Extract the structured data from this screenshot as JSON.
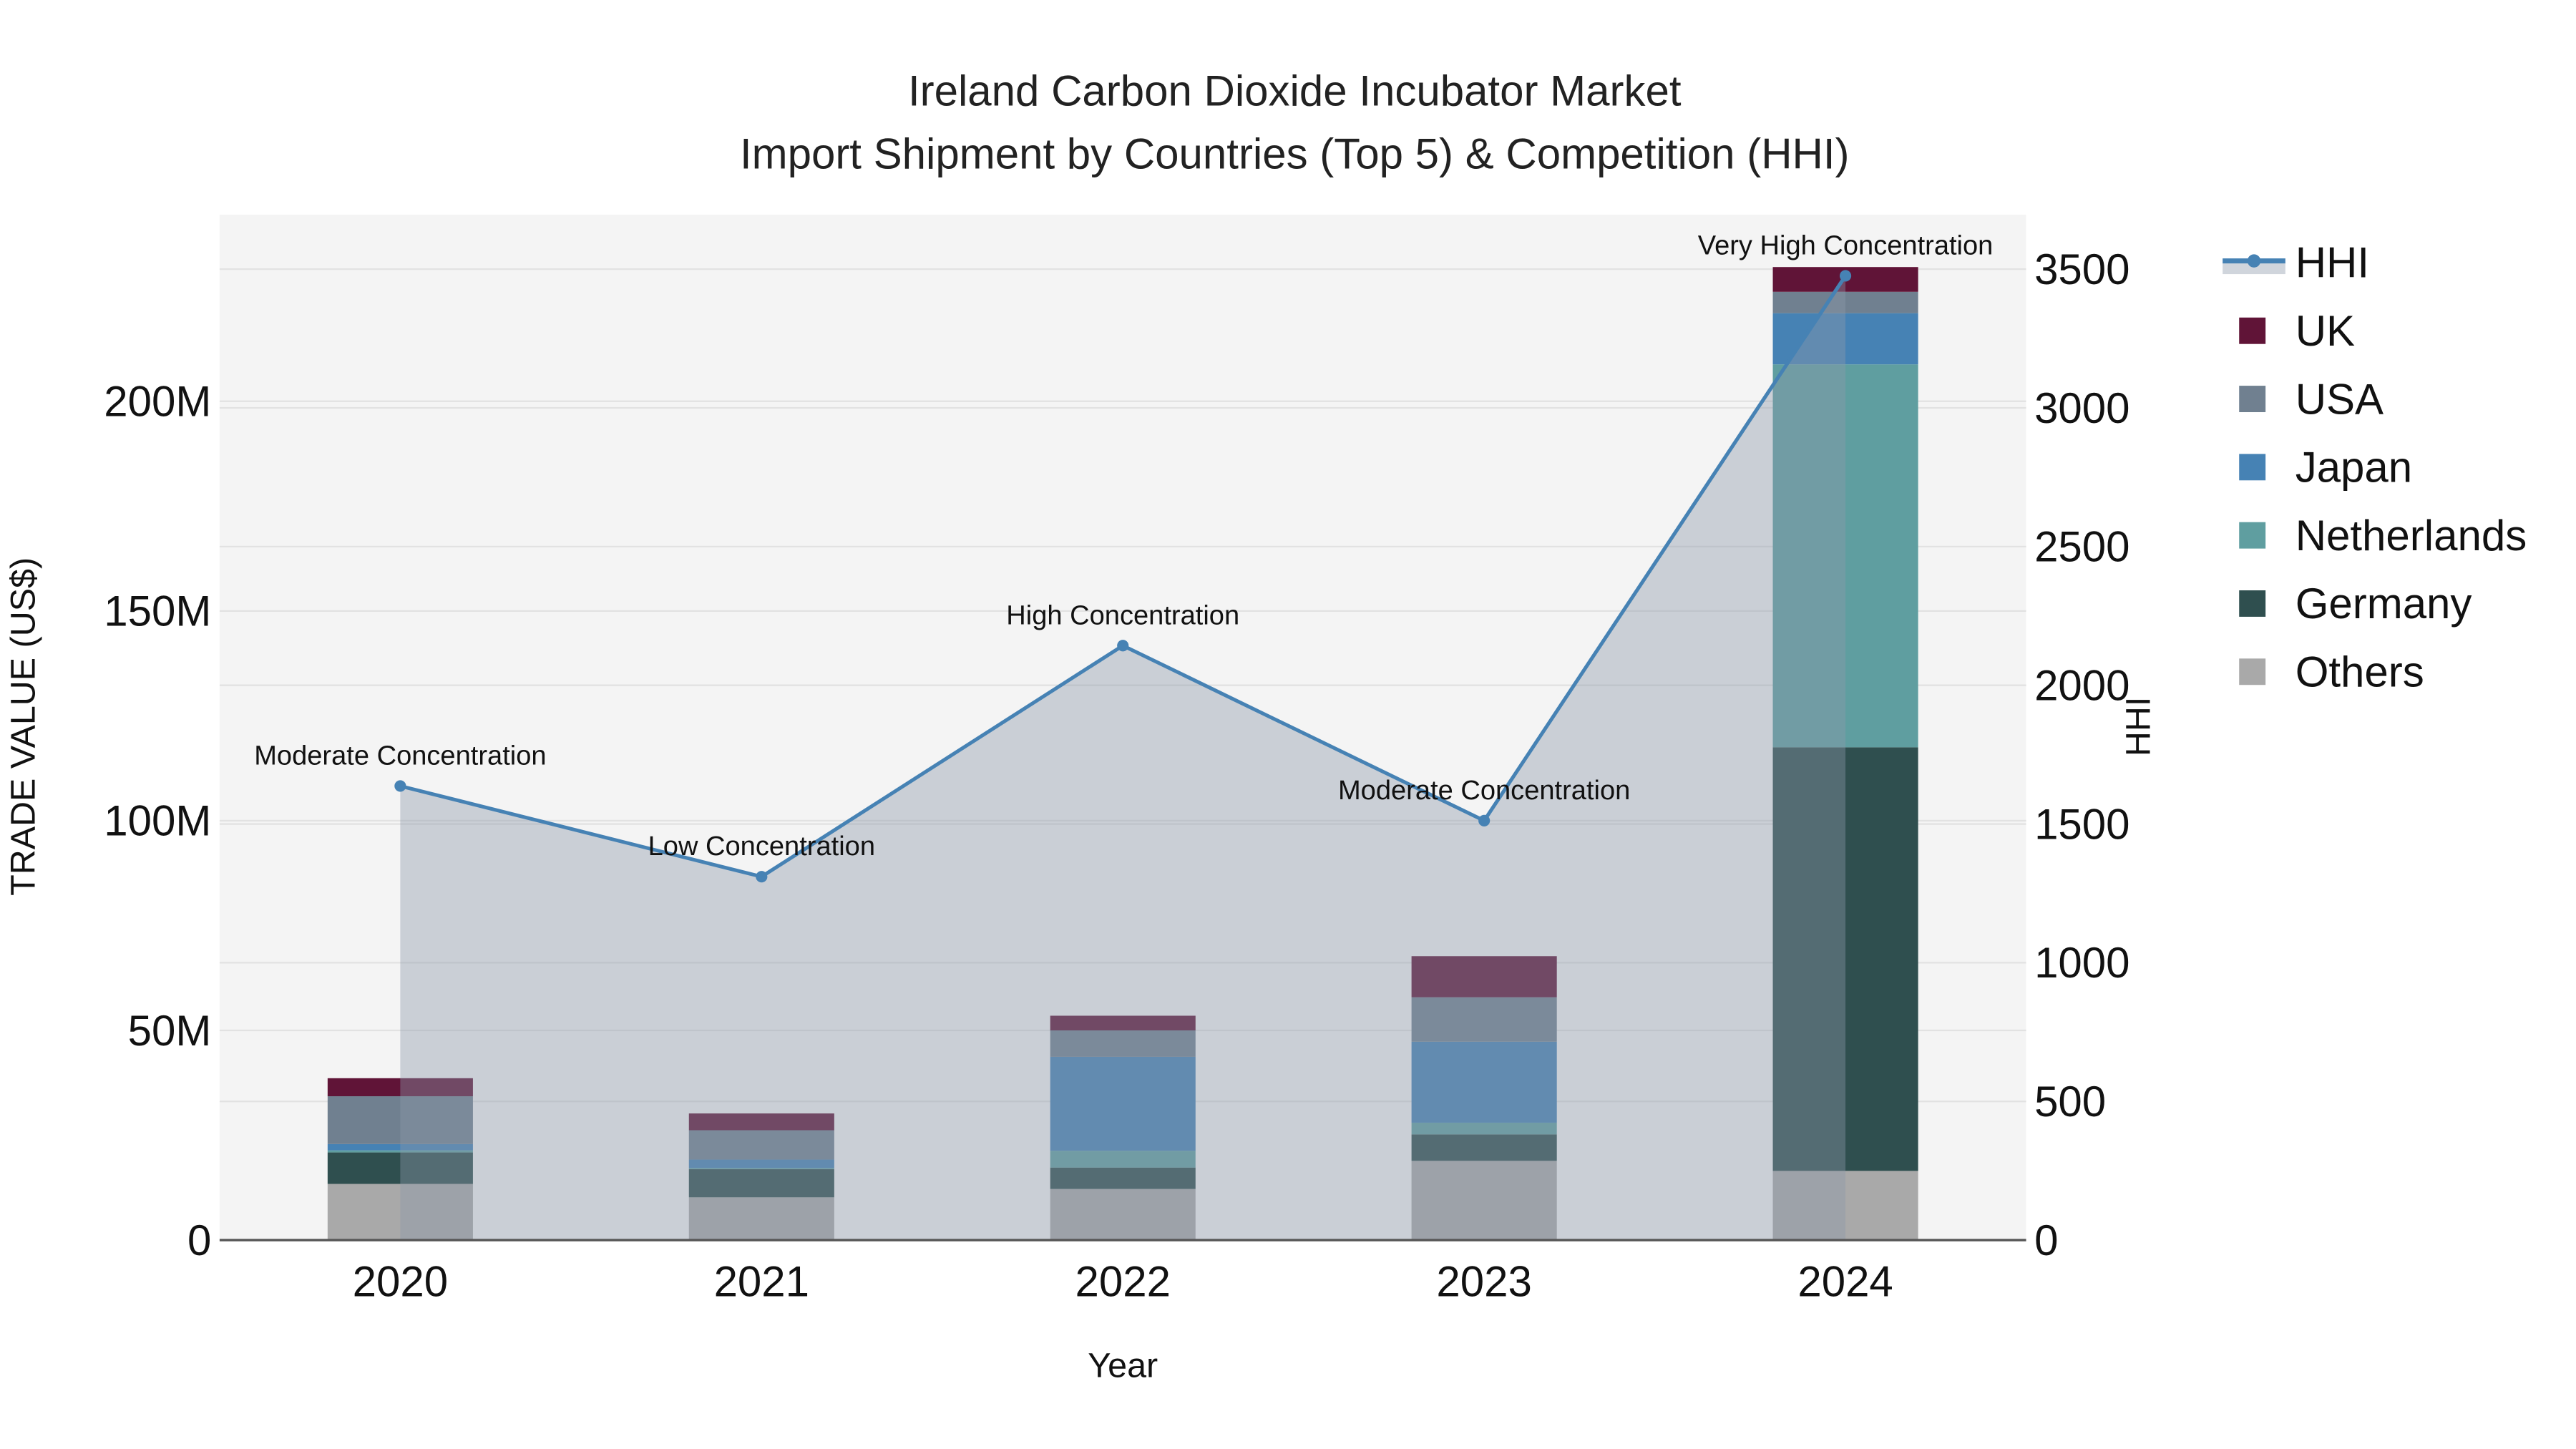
{
  "chart_data": {
    "type": "bar",
    "stacked": true,
    "title": "Ireland Carbon Dioxide Incubator Market",
    "subtitle": "Import Shipment by Countries (Top 5) & Competition (HHI)",
    "xlabel": "Year",
    "ylabel": "TRADE VALUE (US$)",
    "y2label": "HHI",
    "categories": [
      "2020",
      "2021",
      "2022",
      "2023",
      "2024"
    ],
    "ylim": [
      0,
      245
    ],
    "y_unit": "M",
    "yticks": [
      0,
      50,
      100,
      150,
      200
    ],
    "ytick_labels": [
      "0",
      "50M",
      "100M",
      "150M",
      "200M"
    ],
    "y2lim": [
      0,
      3700
    ],
    "y2ticks": [
      0,
      500,
      1000,
      1500,
      2000,
      2500,
      3000,
      3500
    ],
    "y2tick_labels": [
      "0",
      "500",
      "1000",
      "1500",
      "2000",
      "2500",
      "3000",
      "3500"
    ],
    "grid": true,
    "legend_position": "right",
    "series": [
      {
        "name": "Others",
        "color": "#a9a9a9",
        "values": [
          13.4,
          10.2,
          12.2,
          18.9,
          16.5
        ]
      },
      {
        "name": "Germany",
        "color": "#2f4f4f",
        "values": [
          7.5,
          6.7,
          5.1,
          6.3,
          101.0
        ]
      },
      {
        "name": "Netherlands",
        "color": "#5f9ea0",
        "values": [
          0.5,
          0.3,
          4.0,
          2.8,
          91.3
        ]
      },
      {
        "name": "Japan",
        "color": "#4682b4",
        "values": [
          1.5,
          2.0,
          22.4,
          19.3,
          12.2
        ]
      },
      {
        "name": "USA",
        "color": "#708090",
        "values": [
          11.4,
          7.0,
          6.3,
          10.6,
          5.1
        ]
      },
      {
        "name": "UK",
        "color": "#601437",
        "values": [
          4.3,
          4.0,
          3.5,
          9.8,
          5.9
        ]
      }
    ],
    "line_series": {
      "name": "HHI",
      "color": "#4682b4",
      "values": [
        1637,
        1310,
        2143,
        1512,
        3476
      ],
      "annotations": [
        "Moderate Concentration",
        "Low Concentration",
        "High Concentration",
        "Moderate Concentration",
        "Very High Concentration"
      ]
    },
    "legend_order": [
      "HHI",
      "UK",
      "USA",
      "Japan",
      "Netherlands",
      "Germany",
      "Others"
    ]
  }
}
